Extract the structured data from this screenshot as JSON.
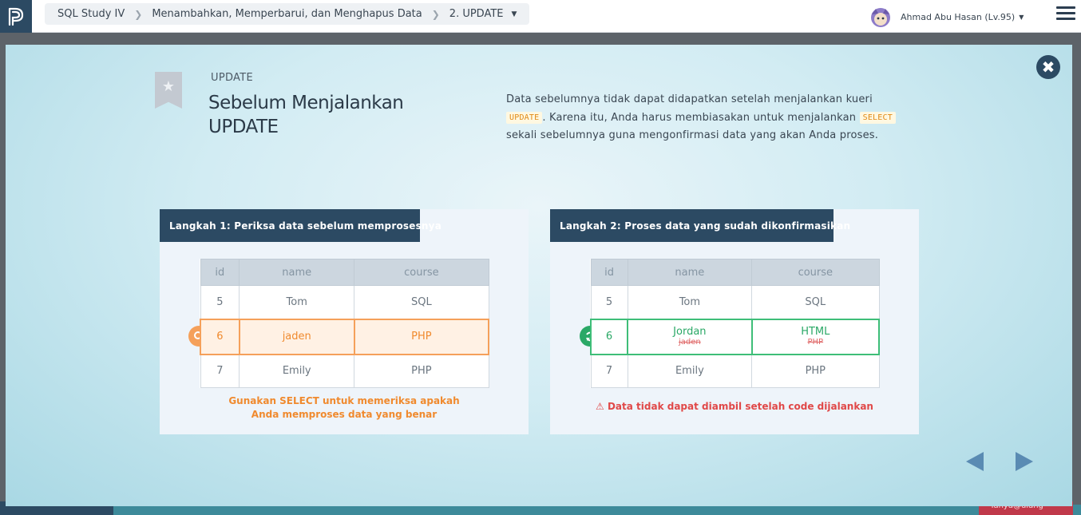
{
  "header": {
    "breadcrumb": [
      "SQL Study IV",
      "Menambahkan, Memperbarui, dan Menghapus Data",
      "2. UPDATE"
    ],
    "user_name": "Ahmad Abu Hasan (Lv.95)",
    "logo_icon": "progate-logo-icon",
    "menu_icon": "hamburger-menu-icon"
  },
  "background": {
    "button_label": "Tanya@ulang"
  },
  "slide": {
    "section": "UPDATE",
    "title_line1": "Sebelum Menjalankan",
    "title_line2": "UPDATE",
    "desc_part1": "Data sebelumnya tidak dapat didapatkan setelah menjalankan kueri",
    "desc_code1": "UPDATE",
    "desc_part2": ". Karena itu, Anda harus membiasakan untuk menjalankan",
    "desc_code2": "SELECT",
    "desc_part3": "sekali sebelumnya guna mengonfirmasi data yang akan Anda proses."
  },
  "step1": {
    "title": "Langkah 1: Periksa data sebelum memprosesnya",
    "columns": [
      "id",
      "name",
      "course"
    ],
    "rows": [
      [
        "5",
        "Tom",
        "SQL"
      ],
      [
        "6",
        "jaden",
        "PHP"
      ],
      [
        "7",
        "Emily",
        "PHP"
      ]
    ],
    "note_line1": "Gunakan SELECT untuk memeriksa apakah",
    "note_line2": "Anda memproses data yang benar",
    "marker_icon": "search-icon"
  },
  "step2": {
    "title": "Langkah 2: Proses data yang sudah dikonfirmasikan",
    "columns": [
      "id",
      "name",
      "course"
    ],
    "rows": [
      [
        "5",
        "Tom",
        "SQL"
      ],
      [
        "6",
        "Jordan",
        "HTML"
      ],
      [
        "7",
        "Emily",
        "PHP"
      ]
    ],
    "old_values": [
      "jaden",
      "PHP"
    ],
    "warning": "Data tidak dapat diambil setelah code dijalankan",
    "warning_icon": "warning-icon",
    "marker_icon": "refresh-icon"
  },
  "colors": {
    "header_dark": "#2c4a63",
    "orange": "#f08a2e",
    "green": "#2aa866",
    "red": "#e04848"
  }
}
